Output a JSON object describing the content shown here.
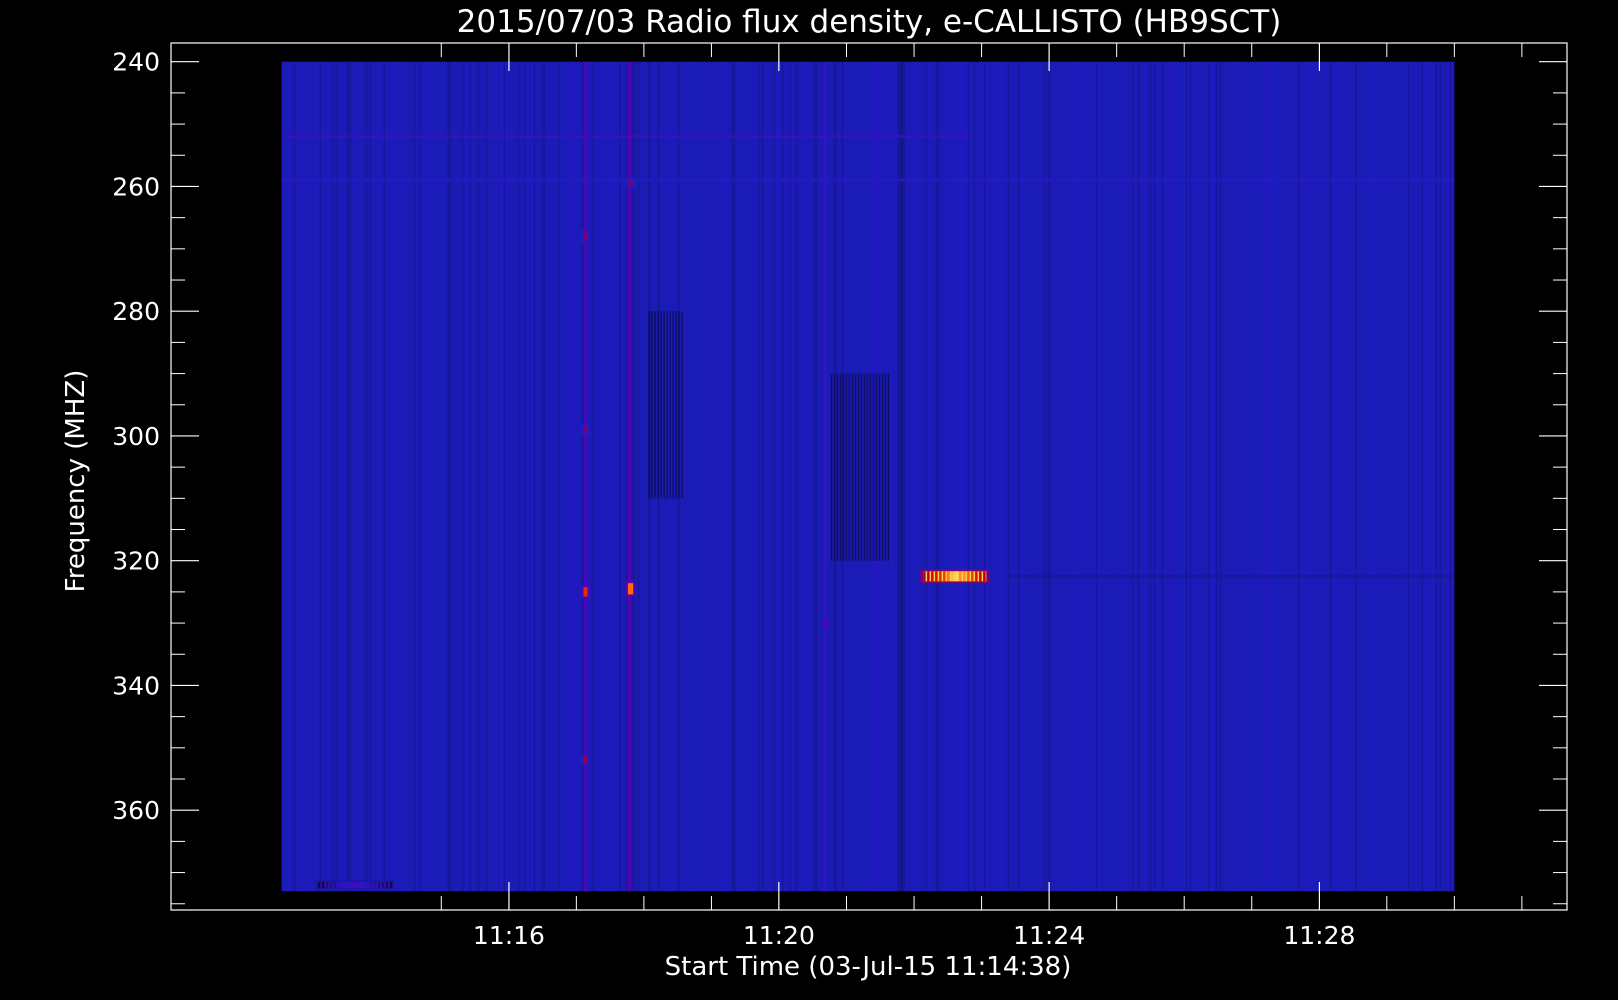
{
  "chart_data": {
    "type": "heatmap",
    "title": "2015/07/03  Radio flux density, e-CALLISTO (HB9SCT)",
    "xlabel": "Start Time (03-Jul-15 11:14:38)",
    "ylabel": "Frequency (MHZ)",
    "x_unit": "time of day (hours)",
    "y_unit": "MHz",
    "xlim": [
      11.1833,
      11.5278
    ],
    "data_xlim": [
      11.2106,
      11.5
    ],
    "ylim": [
      237,
      376
    ],
    "data_ylim": [
      240,
      373
    ],
    "y_inverted": true,
    "x_ticks": [
      {
        "value": 11.2667,
        "label": "11:16"
      },
      {
        "value": 11.3333,
        "label": "11:20"
      },
      {
        "value": 11.4,
        "label": "11:24"
      },
      {
        "value": 11.4667,
        "label": "11:28"
      }
    ],
    "y_ticks": [
      {
        "value": 240,
        "label": "240"
      },
      {
        "value": 260,
        "label": "260"
      },
      {
        "value": 280,
        "label": "280"
      },
      {
        "value": 300,
        "label": "300"
      },
      {
        "value": 320,
        "label": "320"
      },
      {
        "value": 340,
        "label": "340"
      },
      {
        "value": 360,
        "label": "360"
      }
    ],
    "colormap": [
      "#000000",
      "#0f0f6e",
      "#1e1ec8",
      "#5a00b4",
      "#c80000",
      "#ff5a00",
      "#ffff78"
    ],
    "background_level": 0.3,
    "features": [
      {
        "kind": "vertical_line",
        "x": 11.2856,
        "level": 0.45
      },
      {
        "kind": "vertical_line",
        "x": 11.2964,
        "level": 0.5
      },
      {
        "kind": "vertical_line",
        "x": 11.3447,
        "level": 0.38
      },
      {
        "kind": "vertical_line",
        "x": 11.3636,
        "level": 0.22
      },
      {
        "kind": "dark_band",
        "x": [
          11.3011,
          11.3094
        ],
        "y": [
          280,
          310
        ]
      },
      {
        "kind": "dark_band",
        "x": [
          11.3461,
          11.3606
        ],
        "y": [
          290,
          320
        ]
      },
      {
        "kind": "horizontal_line",
        "y": 252,
        "x": [
          11.2106,
          11.38
        ],
        "level": 0.42
      },
      {
        "kind": "horizontal_line",
        "y": 259,
        "x": [
          11.2106,
          11.5
        ],
        "level": 0.36
      },
      {
        "kind": "horizontal_line",
        "y": 322.5,
        "x": [
          11.39,
          11.5
        ],
        "level": 0.25
      },
      {
        "kind": "hotspot",
        "x": 11.3767,
        "y": 322.5,
        "w": 0.0156,
        "h": 1.6,
        "level": 0.95
      },
      {
        "kind": "hotspot",
        "x": 11.2856,
        "y": 325,
        "w": 0.001,
        "h": 1.5,
        "level": 0.75
      },
      {
        "kind": "hotspot",
        "x": 11.2967,
        "y": 324.5,
        "w": 0.0013,
        "h": 1.8,
        "level": 0.85
      },
      {
        "kind": "hotspot",
        "x": 11.2856,
        "y": 352,
        "w": 0.001,
        "h": 1.2,
        "level": 0.6
      },
      {
        "kind": "hotspot",
        "x": 11.2856,
        "y": 268,
        "w": 0.001,
        "h": 1.4,
        "level": 0.55
      },
      {
        "kind": "hotspot",
        "x": 11.2856,
        "y": 299,
        "w": 0.001,
        "h": 1.2,
        "level": 0.55
      },
      {
        "kind": "hotspot",
        "x": 11.2967,
        "y": 259.5,
        "w": 0.0008,
        "h": 1.2,
        "level": 0.55
      },
      {
        "kind": "hotspot",
        "x": 11.3447,
        "y": 330,
        "w": 0.0009,
        "h": 1.5,
        "level": 0.5
      },
      {
        "kind": "hotspot",
        "x": 11.2286,
        "y": 372,
        "w": 0.0181,
        "h": 1.0,
        "level": 0.45
      }
    ]
  }
}
